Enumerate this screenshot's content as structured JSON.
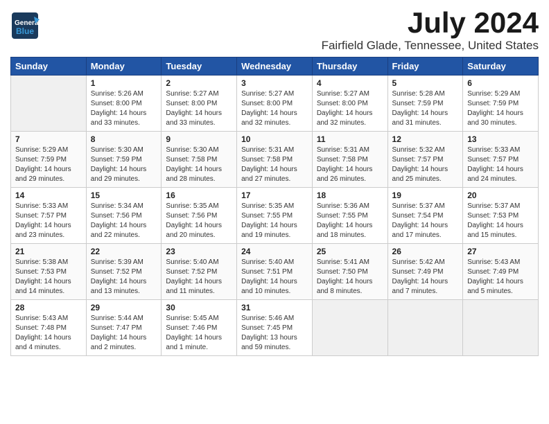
{
  "header": {
    "logo_general": "General",
    "logo_blue": "Blue",
    "month_year": "July 2024",
    "location": "Fairfield Glade, Tennessee, United States"
  },
  "calendar": {
    "weekdays": [
      "Sunday",
      "Monday",
      "Tuesday",
      "Wednesday",
      "Thursday",
      "Friday",
      "Saturday"
    ],
    "rows": [
      [
        {
          "day": "",
          "content": ""
        },
        {
          "day": "1",
          "content": "Sunrise: 5:26 AM\nSunset: 8:00 PM\nDaylight: 14 hours\nand 33 minutes."
        },
        {
          "day": "2",
          "content": "Sunrise: 5:27 AM\nSunset: 8:00 PM\nDaylight: 14 hours\nand 33 minutes."
        },
        {
          "day": "3",
          "content": "Sunrise: 5:27 AM\nSunset: 8:00 PM\nDaylight: 14 hours\nand 32 minutes."
        },
        {
          "day": "4",
          "content": "Sunrise: 5:27 AM\nSunset: 8:00 PM\nDaylight: 14 hours\nand 32 minutes."
        },
        {
          "day": "5",
          "content": "Sunrise: 5:28 AM\nSunset: 7:59 PM\nDaylight: 14 hours\nand 31 minutes."
        },
        {
          "day": "6",
          "content": "Sunrise: 5:29 AM\nSunset: 7:59 PM\nDaylight: 14 hours\nand 30 minutes."
        }
      ],
      [
        {
          "day": "7",
          "content": "Sunrise: 5:29 AM\nSunset: 7:59 PM\nDaylight: 14 hours\nand 29 minutes."
        },
        {
          "day": "8",
          "content": "Sunrise: 5:30 AM\nSunset: 7:59 PM\nDaylight: 14 hours\nand 29 minutes."
        },
        {
          "day": "9",
          "content": "Sunrise: 5:30 AM\nSunset: 7:58 PM\nDaylight: 14 hours\nand 28 minutes."
        },
        {
          "day": "10",
          "content": "Sunrise: 5:31 AM\nSunset: 7:58 PM\nDaylight: 14 hours\nand 27 minutes."
        },
        {
          "day": "11",
          "content": "Sunrise: 5:31 AM\nSunset: 7:58 PM\nDaylight: 14 hours\nand 26 minutes."
        },
        {
          "day": "12",
          "content": "Sunrise: 5:32 AM\nSunset: 7:57 PM\nDaylight: 14 hours\nand 25 minutes."
        },
        {
          "day": "13",
          "content": "Sunrise: 5:33 AM\nSunset: 7:57 PM\nDaylight: 14 hours\nand 24 minutes."
        }
      ],
      [
        {
          "day": "14",
          "content": "Sunrise: 5:33 AM\nSunset: 7:57 PM\nDaylight: 14 hours\nand 23 minutes."
        },
        {
          "day": "15",
          "content": "Sunrise: 5:34 AM\nSunset: 7:56 PM\nDaylight: 14 hours\nand 22 minutes."
        },
        {
          "day": "16",
          "content": "Sunrise: 5:35 AM\nSunset: 7:56 PM\nDaylight: 14 hours\nand 20 minutes."
        },
        {
          "day": "17",
          "content": "Sunrise: 5:35 AM\nSunset: 7:55 PM\nDaylight: 14 hours\nand 19 minutes."
        },
        {
          "day": "18",
          "content": "Sunrise: 5:36 AM\nSunset: 7:55 PM\nDaylight: 14 hours\nand 18 minutes."
        },
        {
          "day": "19",
          "content": "Sunrise: 5:37 AM\nSunset: 7:54 PM\nDaylight: 14 hours\nand 17 minutes."
        },
        {
          "day": "20",
          "content": "Sunrise: 5:37 AM\nSunset: 7:53 PM\nDaylight: 14 hours\nand 15 minutes."
        }
      ],
      [
        {
          "day": "21",
          "content": "Sunrise: 5:38 AM\nSunset: 7:53 PM\nDaylight: 14 hours\nand 14 minutes."
        },
        {
          "day": "22",
          "content": "Sunrise: 5:39 AM\nSunset: 7:52 PM\nDaylight: 14 hours\nand 13 minutes."
        },
        {
          "day": "23",
          "content": "Sunrise: 5:40 AM\nSunset: 7:52 PM\nDaylight: 14 hours\nand 11 minutes."
        },
        {
          "day": "24",
          "content": "Sunrise: 5:40 AM\nSunset: 7:51 PM\nDaylight: 14 hours\nand 10 minutes."
        },
        {
          "day": "25",
          "content": "Sunrise: 5:41 AM\nSunset: 7:50 PM\nDaylight: 14 hours\nand 8 minutes."
        },
        {
          "day": "26",
          "content": "Sunrise: 5:42 AM\nSunset: 7:49 PM\nDaylight: 14 hours\nand 7 minutes."
        },
        {
          "day": "27",
          "content": "Sunrise: 5:43 AM\nSunset: 7:49 PM\nDaylight: 14 hours\nand 5 minutes."
        }
      ],
      [
        {
          "day": "28",
          "content": "Sunrise: 5:43 AM\nSunset: 7:48 PM\nDaylight: 14 hours\nand 4 minutes."
        },
        {
          "day": "29",
          "content": "Sunrise: 5:44 AM\nSunset: 7:47 PM\nDaylight: 14 hours\nand 2 minutes."
        },
        {
          "day": "30",
          "content": "Sunrise: 5:45 AM\nSunset: 7:46 PM\nDaylight: 14 hours\nand 1 minute."
        },
        {
          "day": "31",
          "content": "Sunrise: 5:46 AM\nSunset: 7:45 PM\nDaylight: 13 hours\nand 59 minutes."
        },
        {
          "day": "",
          "content": ""
        },
        {
          "day": "",
          "content": ""
        },
        {
          "day": "",
          "content": ""
        }
      ]
    ]
  }
}
